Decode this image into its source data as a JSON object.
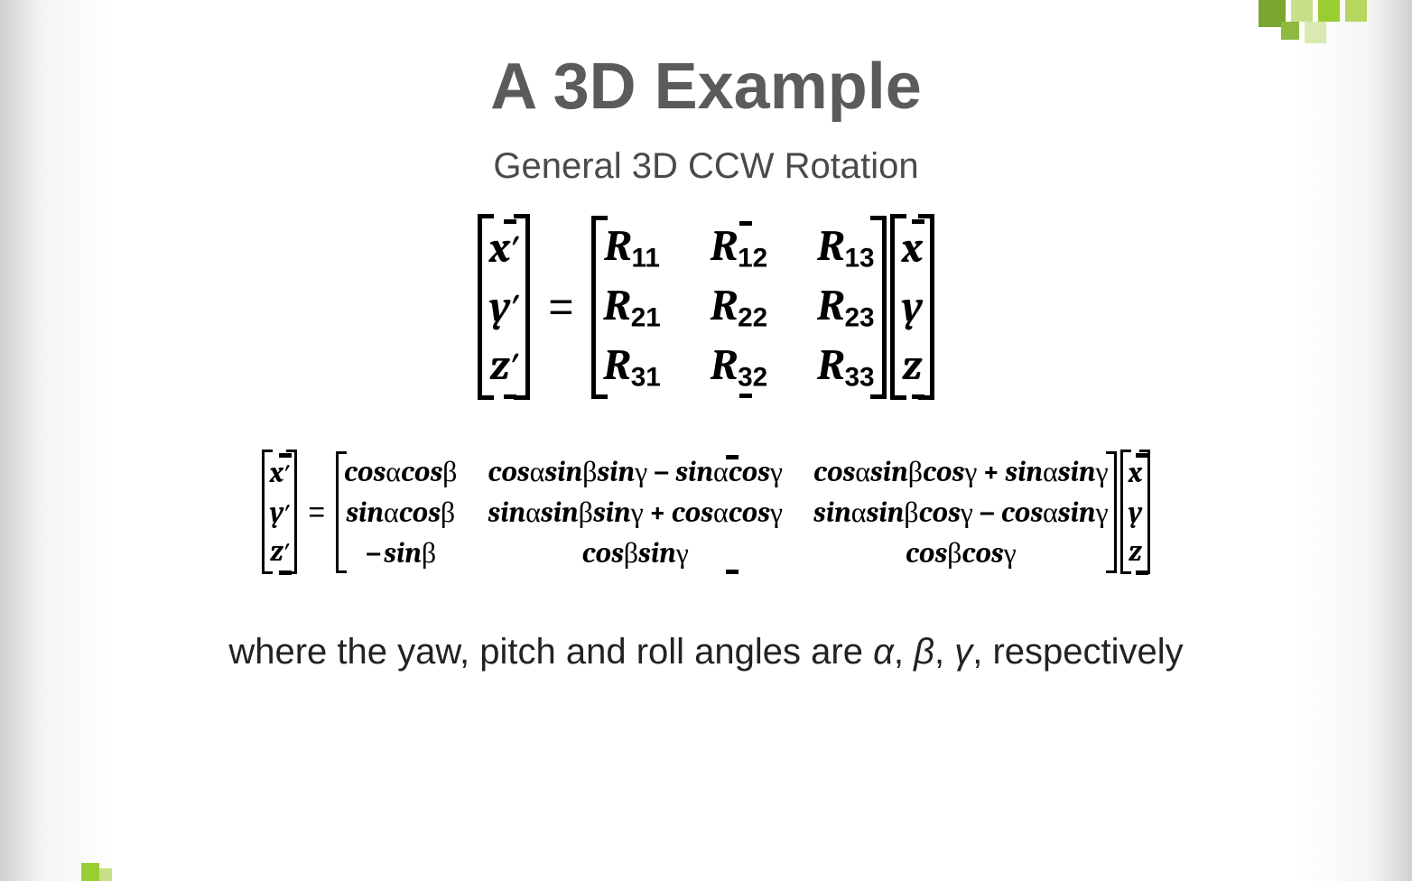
{
  "title": "A 3D Example",
  "subtitle": "General 3D CCW Rotation",
  "vec_out": {
    "x": "x",
    "y": "y",
    "z": "z",
    "prime": "′"
  },
  "vec_in": {
    "x": "x",
    "y": "y",
    "z": "z"
  },
  "R": {
    "sym": "R",
    "idx": [
      "11",
      "12",
      "13",
      "21",
      "22",
      "23",
      "31",
      "32",
      "33"
    ]
  },
  "eq_sign": "=",
  "trig": {
    "cos": "cos",
    "sin": "sin",
    "alpha": "α",
    "beta": "β",
    "gamma": "γ",
    "minus": "−",
    "plus": "+",
    "neg": "−"
  },
  "M": {
    "r1c1": [
      "cos",
      "α",
      "cos",
      "β"
    ],
    "r1c2": [
      "cos",
      "α",
      "sin",
      "β",
      "sin",
      "γ",
      " − ",
      "sin",
      "α",
      "cos",
      "γ"
    ],
    "r1c3": [
      "cos",
      "α",
      "sin",
      "β",
      "cos",
      "γ",
      " + ",
      "sin",
      "α",
      "sin",
      "γ"
    ],
    "r2c1": [
      "sin",
      "α",
      "cos",
      "β"
    ],
    "r2c2": [
      "sin",
      "α",
      "sin",
      "β",
      "sin",
      "γ",
      " + ",
      "cos",
      "α",
      "cos",
      "γ"
    ],
    "r2c3": [
      "sin",
      "α",
      "sin",
      "β",
      "cos",
      "γ",
      " − ",
      "cos",
      "α",
      "sin",
      "γ"
    ],
    "r3c1": [
      "−",
      "sin",
      "β"
    ],
    "r3c2": [
      "cos",
      "β",
      "sin",
      "γ"
    ],
    "r3c3": [
      "cos",
      "β",
      "cos",
      "γ"
    ]
  },
  "footnote_a": "where the yaw, pitch and roll angles are ",
  "footnote_b": ", respectively",
  "foot_greek": {
    "a": "α",
    "b": "β",
    "c": "γ",
    "sep": ", "
  },
  "deco_colors": [
    "#9acd32",
    "#c8e08a",
    "#7aa52e",
    "#b5d65f",
    "#d9eab0",
    "#8fb93e"
  ]
}
